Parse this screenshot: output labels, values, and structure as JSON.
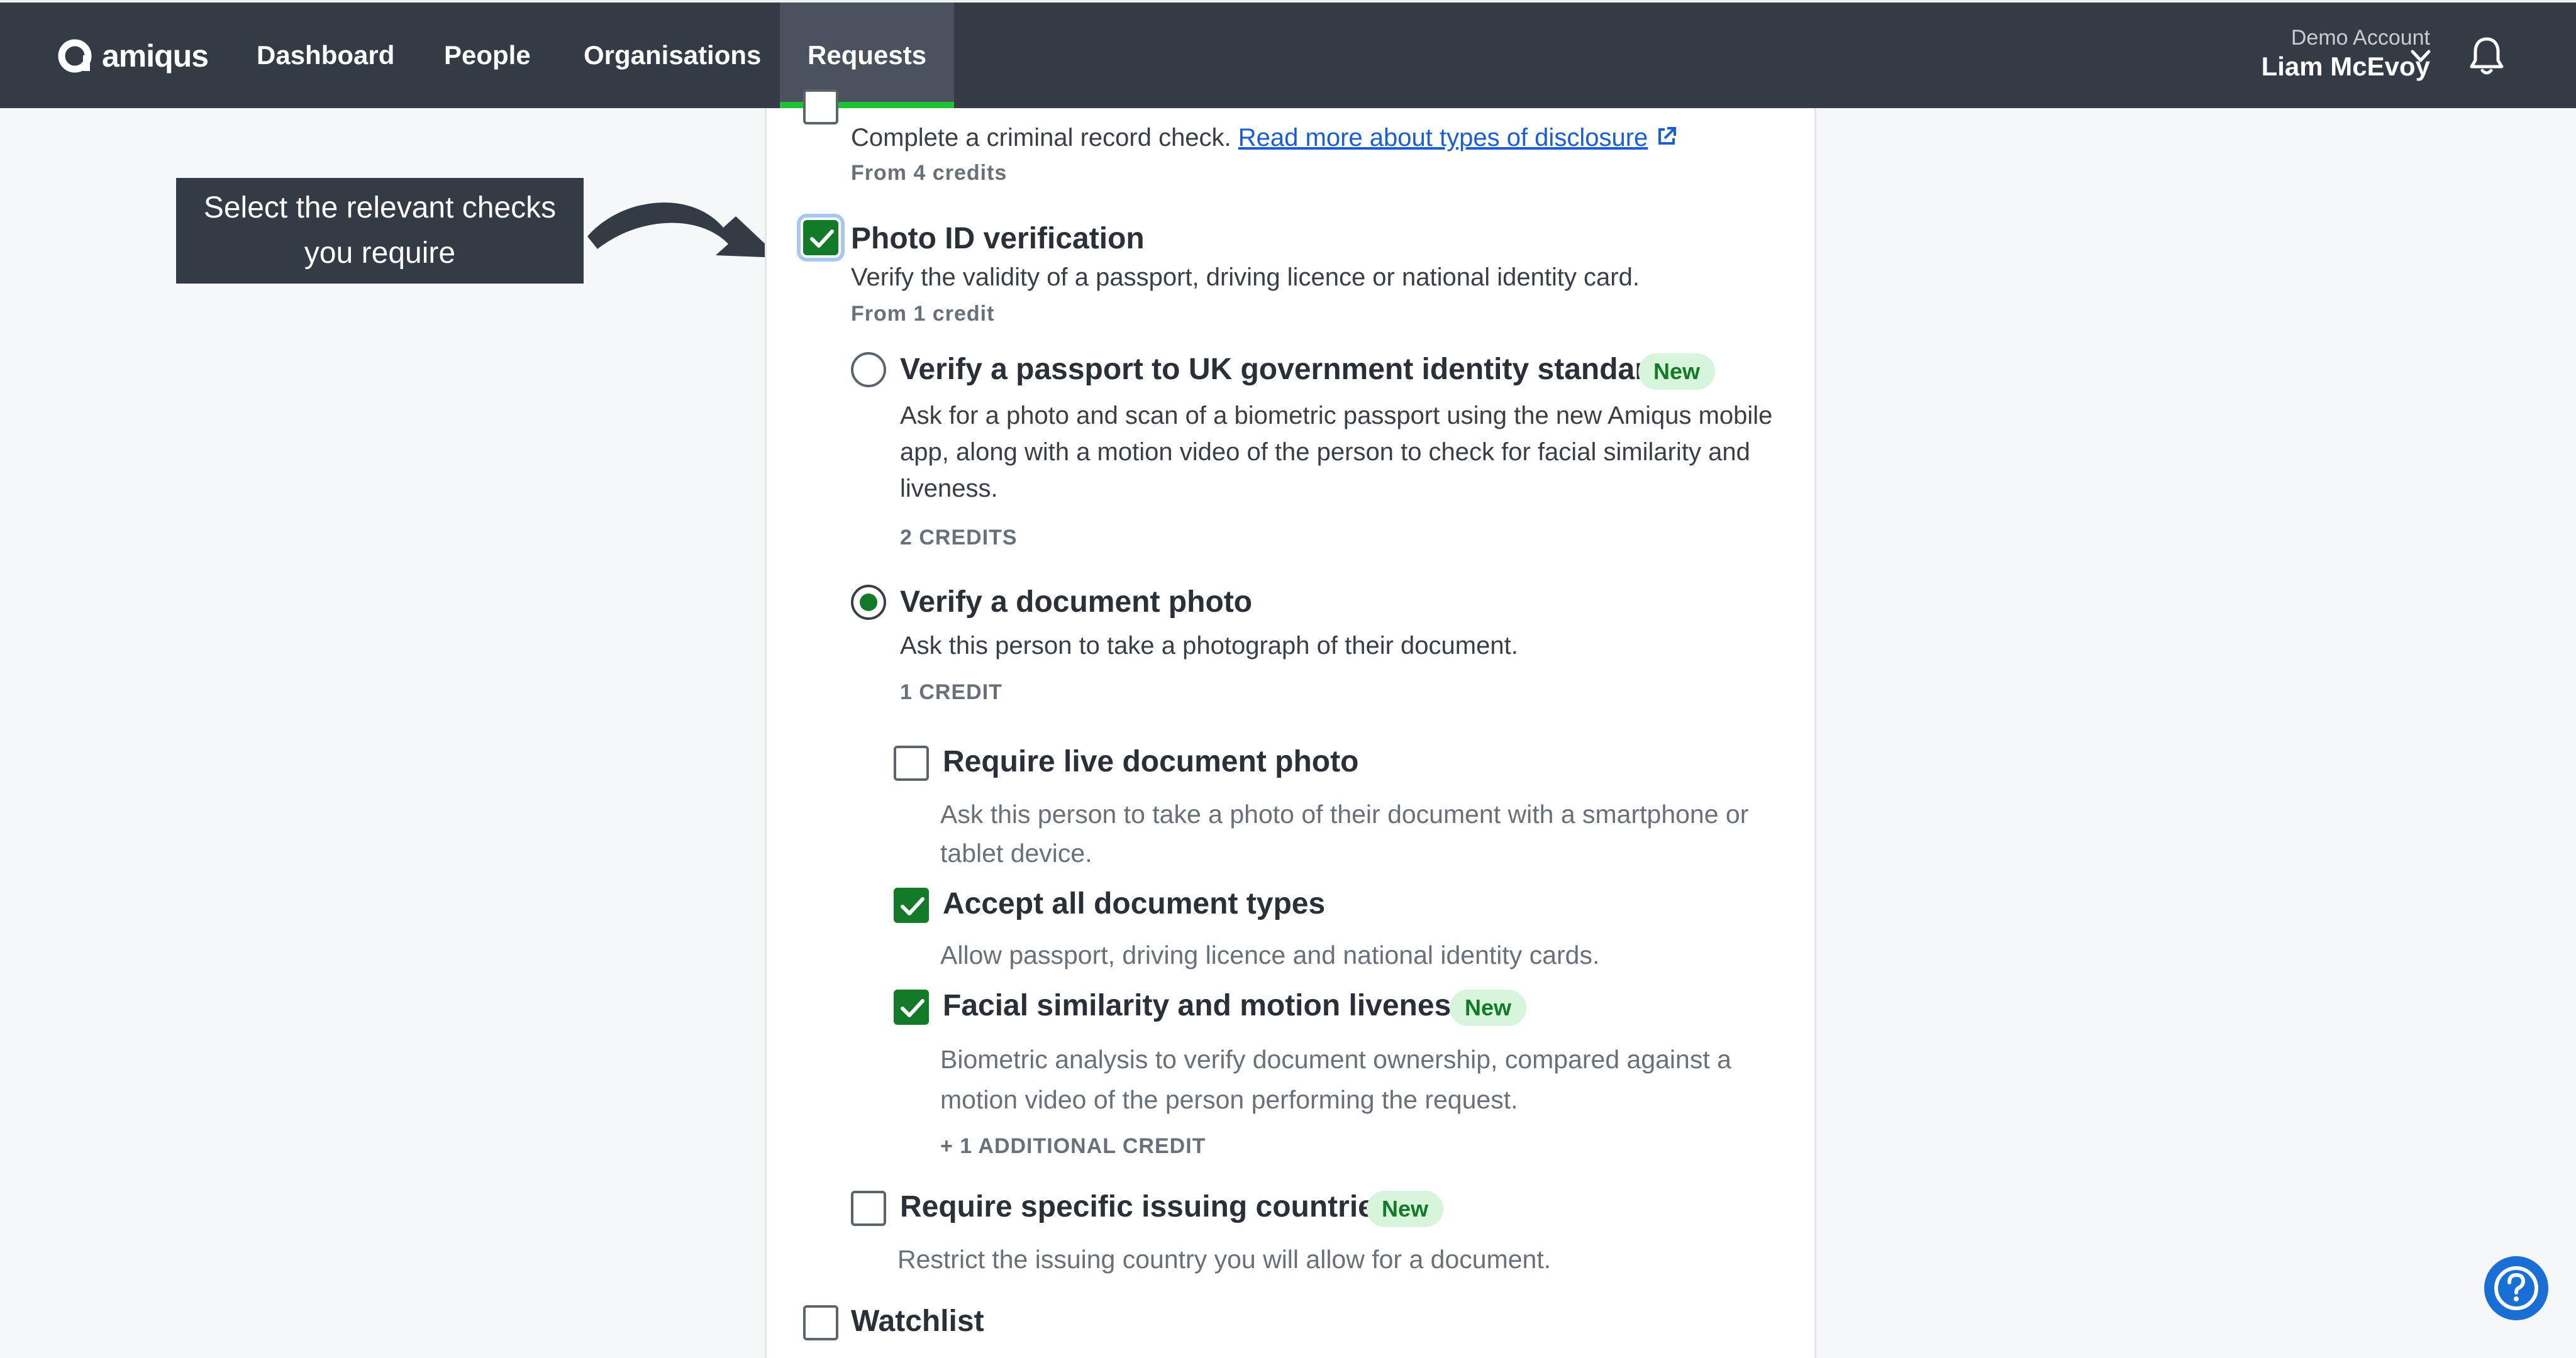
{
  "app": {
    "logo_text": "amiqus",
    "nav": [
      "Dashboard",
      "People",
      "Organisations",
      "Requests"
    ],
    "active_nav": "Requests",
    "account_type": "Demo Account",
    "account_name": "Liam McEvoy"
  },
  "callout": {
    "text": "Select the relevant checks you require"
  },
  "criminal": {
    "desc": "Complete a criminal record check.",
    "link": "Read more about types of disclosure",
    "credit": "From 4 credits"
  },
  "photo_id": {
    "title": "Photo ID verification",
    "checked": true,
    "desc": "Verify the validity of a passport, driving licence or national identity card.",
    "credit": "From 1 credit",
    "options": [
      {
        "title": "Verify a passport to UK government identity standard",
        "badge": "New",
        "selected": false,
        "desc_lines": [
          "Ask for a photo and scan of a biometric passport using the new Amiqus mobile",
          "app, along with a motion video of the person to check for facial similarity and",
          "liveness."
        ],
        "credit": "2 CREDITS"
      },
      {
        "title": "Verify a document photo",
        "selected": true,
        "desc": "Ask this person to take a photograph of their document.",
        "credit": "1 CREDIT"
      }
    ],
    "sub_options": [
      {
        "title": "Require live document photo",
        "checked": false,
        "desc_lines": [
          "Ask this person to take a photo of their document with a smartphone or",
          "tablet device."
        ]
      },
      {
        "title": "Accept all document types",
        "checked": true,
        "desc_lines": [
          "Allow passport, driving licence and national identity cards."
        ]
      },
      {
        "title": "Facial similarity and motion liveness",
        "badge": "New",
        "checked": true,
        "desc_lines": [
          "Biometric analysis to verify document ownership, compared against a",
          "motion video of the person performing the request."
        ],
        "credit": "+ 1 ADDITIONAL CREDIT"
      }
    ],
    "issuing": {
      "title": "Require specific issuing countries",
      "badge": "New",
      "checked": false,
      "desc": "Restrict the issuing country you will allow for a document."
    }
  },
  "watchlist": {
    "title": "Watchlist",
    "checked": false
  },
  "colors": {
    "nav_bg": "#343b45",
    "accent_green": "#137a27",
    "nav_active_bar": "#1fc136",
    "link_blue": "#1a5dd6",
    "help_blue": "#1a6fd6",
    "badge_bg": "#d6f5da"
  }
}
